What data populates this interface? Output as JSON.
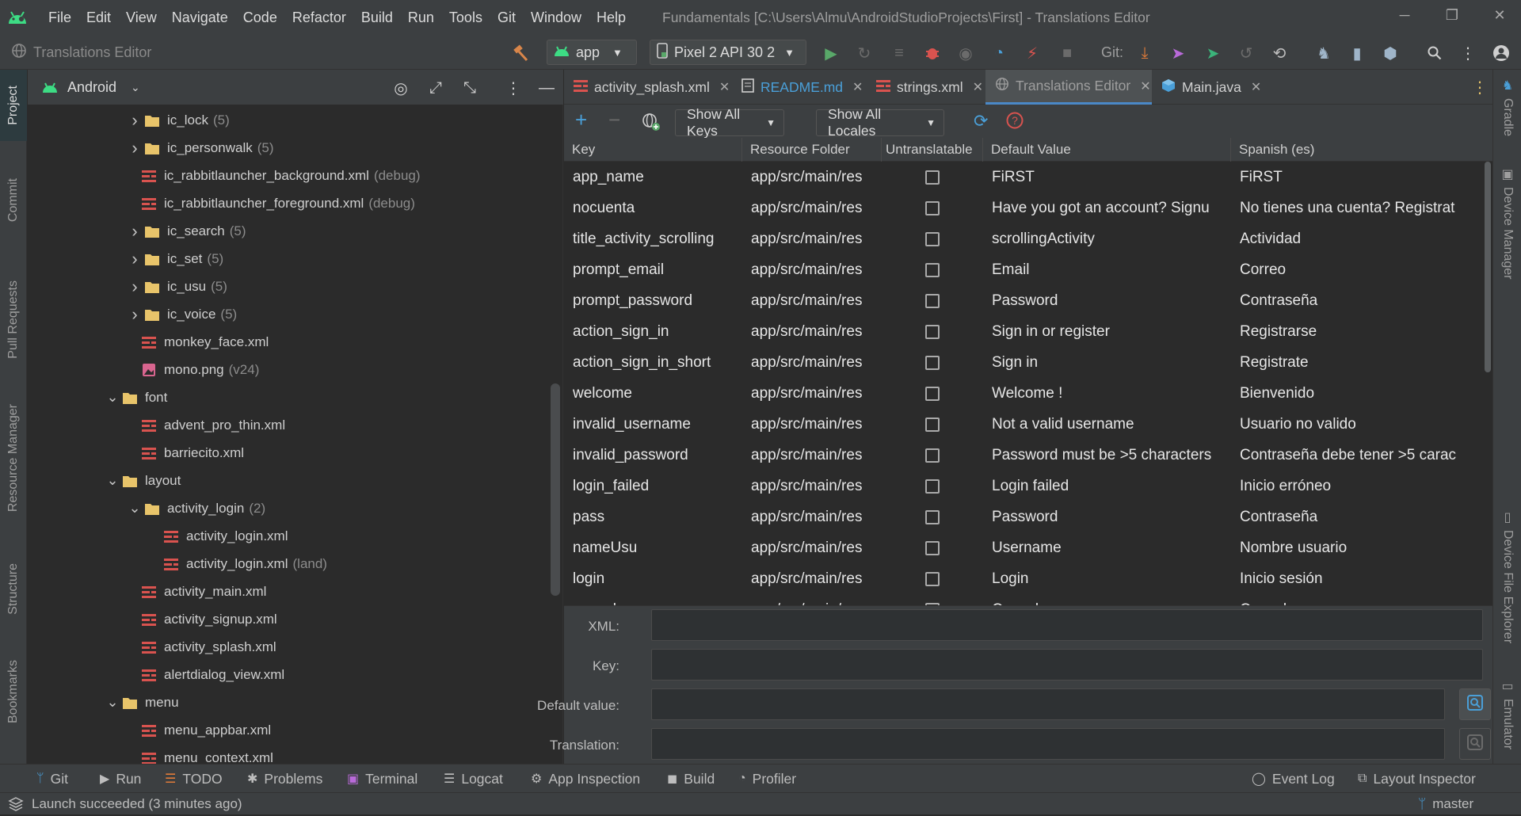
{
  "window": {
    "title": "Fundamentals [C:\\Users\\Almu\\AndroidStudioProjects\\First] - Translations Editor",
    "minimize": "─",
    "restore": "❐",
    "close": "✕"
  },
  "menu": [
    "File",
    "Edit",
    "View",
    "Navigate",
    "Code",
    "Refactor",
    "Build",
    "Run",
    "Tools",
    "Git",
    "Window",
    "Help"
  ],
  "toolbar": {
    "breadcrumb": "Translations Editor",
    "run_config": "app",
    "device": "Pixel 2 API 30 2",
    "git_label": "Git:"
  },
  "left_strip": [
    "Project",
    "Commit",
    "Pull Requests",
    "Resource Manager",
    "Structure",
    "Bookmarks"
  ],
  "project_panel": {
    "view": "Android",
    "tree": [
      {
        "label": "ic_lock",
        "suffix": "(5)",
        "type": "folder",
        "depth": 1,
        "expanded": false
      },
      {
        "label": "ic_personwalk",
        "suffix": "(5)",
        "type": "folder",
        "depth": 1,
        "expanded": false
      },
      {
        "label": "ic_rabbitlauncher_background.xml",
        "suffix": "(debug)",
        "type": "xml",
        "depth": 1
      },
      {
        "label": "ic_rabbitlauncher_foreground.xml",
        "suffix": "(debug)",
        "type": "xml",
        "depth": 1
      },
      {
        "label": "ic_search",
        "suffix": "(5)",
        "type": "folder",
        "depth": 1,
        "expanded": false
      },
      {
        "label": "ic_set",
        "suffix": "(5)",
        "type": "folder",
        "depth": 1,
        "expanded": false
      },
      {
        "label": "ic_usu",
        "suffix": "(5)",
        "type": "folder",
        "depth": 1,
        "expanded": false
      },
      {
        "label": "ic_voice",
        "suffix": "(5)",
        "type": "folder",
        "depth": 1,
        "expanded": false
      },
      {
        "label": "monkey_face.xml",
        "suffix": "",
        "type": "xml",
        "depth": 1
      },
      {
        "label": "mono.png",
        "suffix": "(v24)",
        "type": "image",
        "depth": 1
      },
      {
        "label": "font",
        "suffix": "",
        "type": "folder",
        "depth": 0,
        "expanded": true
      },
      {
        "label": "advent_pro_thin.xml",
        "suffix": "",
        "type": "xml",
        "depth": 1
      },
      {
        "label": "barriecito.xml",
        "suffix": "",
        "type": "xml",
        "depth": 1
      },
      {
        "label": "layout",
        "suffix": "",
        "type": "folder",
        "depth": 0,
        "expanded": true
      },
      {
        "label": "activity_login",
        "suffix": "(2)",
        "type": "folder",
        "depth": 1,
        "expanded": true
      },
      {
        "label": "activity_login.xml",
        "suffix": "",
        "type": "xml",
        "depth": 2
      },
      {
        "label": "activity_login.xml",
        "suffix": "(land)",
        "type": "xml",
        "depth": 2
      },
      {
        "label": "activity_main.xml",
        "suffix": "",
        "type": "xml",
        "depth": 1
      },
      {
        "label": "activity_signup.xml",
        "suffix": "",
        "type": "xml",
        "depth": 1
      },
      {
        "label": "activity_splash.xml",
        "suffix": "",
        "type": "xml",
        "depth": 1
      },
      {
        "label": "alertdialog_view.xml",
        "suffix": "",
        "type": "xml",
        "depth": 1
      },
      {
        "label": "menu",
        "suffix": "",
        "type": "folder",
        "depth": 0,
        "expanded": true
      },
      {
        "label": "menu_appbar.xml",
        "suffix": "",
        "type": "xml",
        "depth": 1
      },
      {
        "label": "menu_context.xml",
        "suffix": "",
        "type": "xml",
        "depth": 1
      }
    ]
  },
  "editor_tabs": [
    {
      "label": "activity_splash.xml",
      "icon": "xml-icon",
      "active": false
    },
    {
      "label": "README.md",
      "icon": "markdown-icon",
      "active": false
    },
    {
      "label": "strings.xml",
      "icon": "xml-icon",
      "active": false
    },
    {
      "label": "Translations Editor",
      "icon": "globe-icon",
      "active": true
    },
    {
      "label": "Main.java",
      "icon": "java-class-icon",
      "active": false
    }
  ],
  "translations": {
    "show_keys": "Show All Keys",
    "show_locales": "Show All Locales",
    "columns": [
      "Key",
      "Resource Folder",
      "Untranslatable",
      "Default Value",
      "Spanish (es)"
    ],
    "rows": [
      {
        "key": "app_name",
        "folder": "app/src/main/res",
        "default": "FiRST",
        "es": "FiRST"
      },
      {
        "key": "nocuenta",
        "folder": "app/src/main/res",
        "default": "Have you got an account? Signu",
        "es": "No tienes una cuenta? Registrat"
      },
      {
        "key": "title_activity_scrolling",
        "folder": "app/src/main/res",
        "default": "scrollingActivity",
        "es": "Actividad"
      },
      {
        "key": "prompt_email",
        "folder": "app/src/main/res",
        "default": "Email",
        "es": "Correo"
      },
      {
        "key": "prompt_password",
        "folder": "app/src/main/res",
        "default": "Password",
        "es": "Contraseña"
      },
      {
        "key": "action_sign_in",
        "folder": "app/src/main/res",
        "default": "Sign in or register",
        "es": "Registrarse"
      },
      {
        "key": "action_sign_in_short",
        "folder": "app/src/main/res",
        "default": "Sign in",
        "es": "Registrate"
      },
      {
        "key": "welcome",
        "folder": "app/src/main/res",
        "default": "Welcome !",
        "es": "Bienvenido"
      },
      {
        "key": "invalid_username",
        "folder": "app/src/main/res",
        "default": "Not a valid username",
        "es": "Usuario no valido"
      },
      {
        "key": "invalid_password",
        "folder": "app/src/main/res",
        "default": "Password must be >5 characters",
        "es": "Contraseña debe tener >5 carac"
      },
      {
        "key": "login_failed",
        "folder": "app/src/main/res",
        "default": "Login failed",
        "es": "Inicio erróneo"
      },
      {
        "key": "pass",
        "folder": "app/src/main/res",
        "default": "Password",
        "es": "Contraseña"
      },
      {
        "key": "nameUsu",
        "folder": "app/src/main/res",
        "default": "Username",
        "es": "Nombre usuario"
      },
      {
        "key": "login",
        "folder": "app/src/main/res",
        "default": "Login",
        "es": "Inicio sesión"
      },
      {
        "key": "cancel",
        "folder": "app/src/main/res",
        "default": "Cancel",
        "es": "Cancelar"
      }
    ],
    "form": {
      "xml_label": "XML:",
      "key_label": "Key:",
      "default_label": "Default value:",
      "translation_label": "Translation:"
    }
  },
  "right_strip": [
    "Gradle",
    "Device Manager",
    "Device File Explorer",
    "Emulator"
  ],
  "bottom_tools": [
    "Git",
    "Run",
    "TODO",
    "Problems",
    "Terminal",
    "Logcat",
    "App Inspection",
    "Build",
    "Profiler",
    "Event Log",
    "Layout Inspector"
  ],
  "status": {
    "message": "Launch succeeded (3 minutes ago)",
    "branch": "master"
  },
  "colors": {
    "accent": "#4a88c7",
    "folder": "#e8c46a",
    "xml": "#d9534f",
    "run": "#59a869",
    "android": "#3ddc84"
  }
}
